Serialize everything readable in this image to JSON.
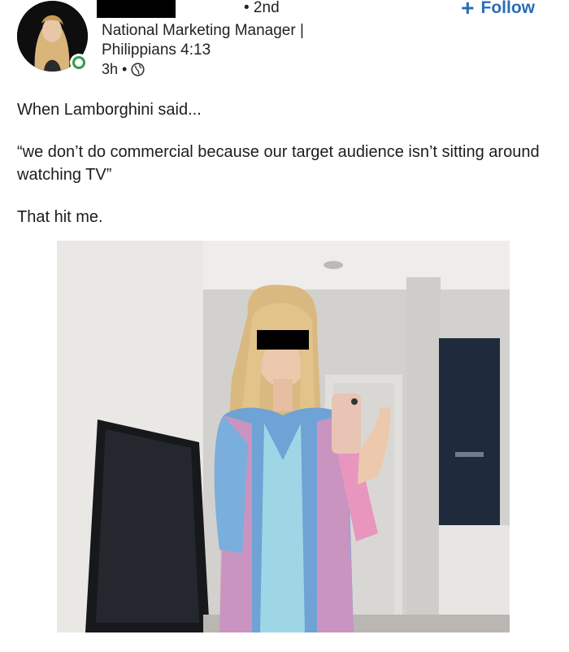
{
  "post": {
    "author": {
      "degree": "• 2nd",
      "headline": "National Marketing Manager | Philippians 4:13",
      "time": "3h •",
      "visibility_icon": "globe-icon"
    },
    "follow_label": "Follow",
    "text": {
      "line1": "When Lamborghini said...",
      "line2": "“we don’t do commercial because our target audience isn’t sitting around watching TV”",
      "line3": "That hit me."
    }
  },
  "colors": {
    "follow": "#2b6cb8",
    "online": "#2e9e46"
  }
}
